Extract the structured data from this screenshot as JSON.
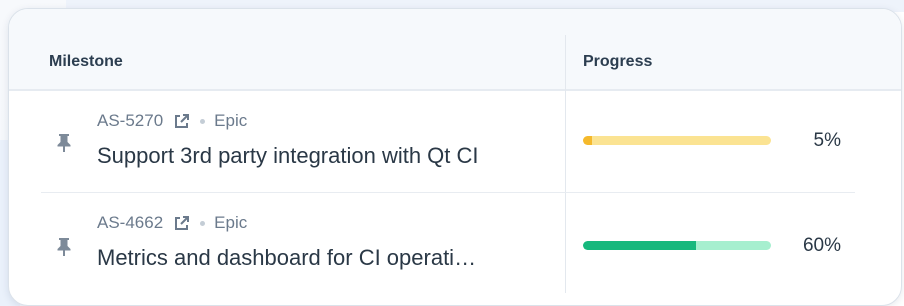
{
  "table": {
    "headers": {
      "milestone": "Milestone",
      "progress": "Progress"
    },
    "rows": [
      {
        "key": "AS-5270",
        "type": "Epic",
        "title": "Support 3rd party integration with Qt CI",
        "progress_percent": 5,
        "progress_label": "5%",
        "bar_color": "#f5b92c",
        "track_color": "#fbe392"
      },
      {
        "key": "AS-4662",
        "type": "Epic",
        "title": "Metrics and dashboard for CI operati…",
        "progress_percent": 60,
        "progress_label": "60%",
        "bar_color": "#17b87d",
        "track_color": "#a6efcf"
      }
    ]
  },
  "icons": {
    "pin": "pin-icon",
    "external_link": "external-link-icon"
  }
}
